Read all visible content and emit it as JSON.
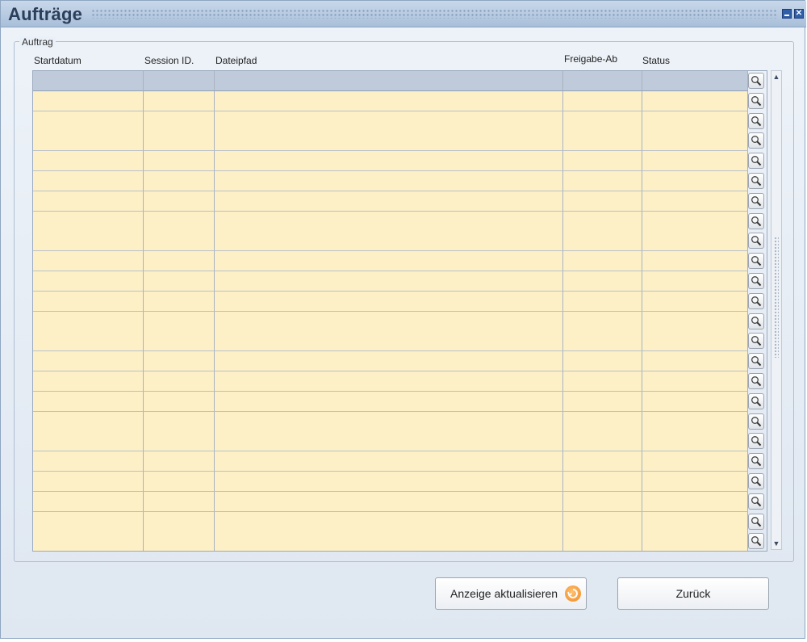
{
  "window": {
    "title": "Aufträge",
    "minimize_icon": "minimize-icon",
    "close_icon": "close-icon",
    "close_glyph": "✕"
  },
  "fieldset": {
    "legend": "Auftrag"
  },
  "table": {
    "columns": [
      "Startdatum",
      "Session ID.",
      "Dateipfad",
      "Freigabe-Ab",
      "Status"
    ],
    "row_count": 24,
    "lookup_icon": "magnifier-icon",
    "row_color": "#fdf0c6",
    "header_color": "#bfcbdb"
  },
  "scrollbar": {
    "up": "▲",
    "down": "▼"
  },
  "buttons": {
    "refresh_label": "Anzeige aktualisieren",
    "refresh_icon": "refresh-icon",
    "back_label": "Zurück"
  }
}
